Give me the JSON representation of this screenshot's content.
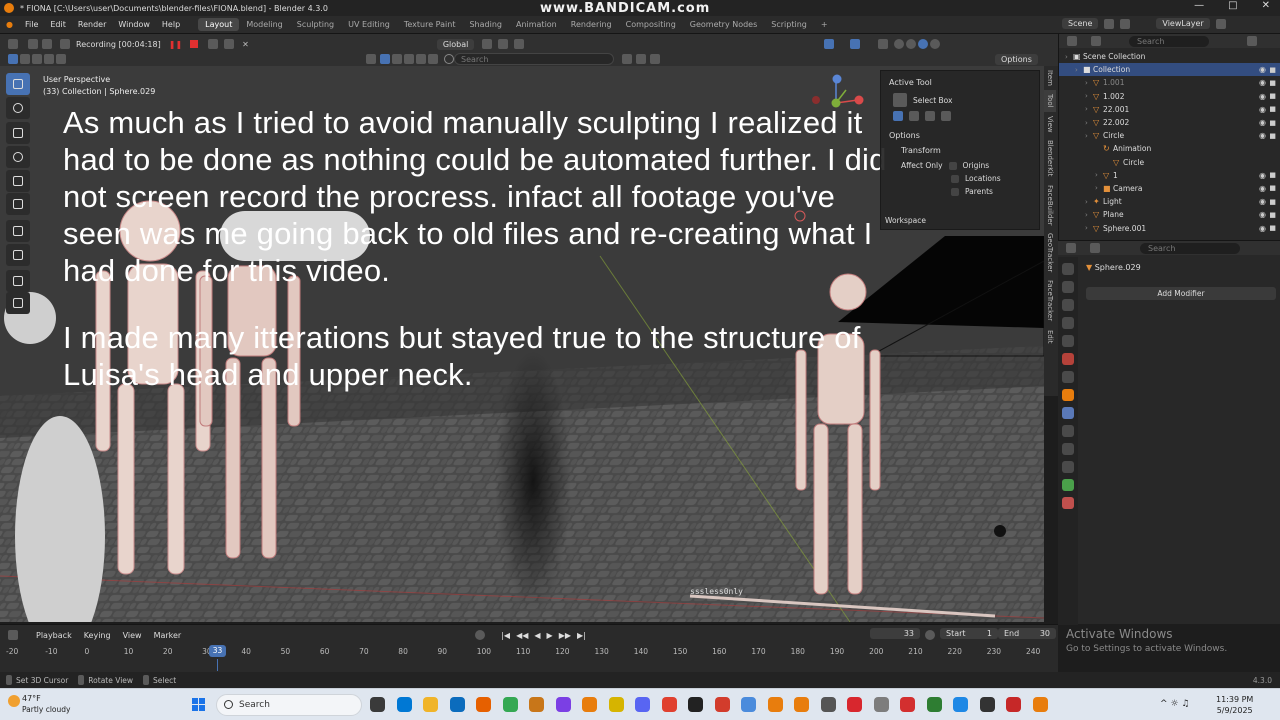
{
  "window": {
    "title": "* FIONA [C:\\Users\\user\\Documents\\blender-files\\FIONA.blend] - Blender 4.3.0",
    "watermark": "www.BANDICAM.com"
  },
  "menu": [
    "File",
    "Edit",
    "Render",
    "Window",
    "Help"
  ],
  "workspaces": [
    "Layout",
    "Modeling",
    "Sculpting",
    "UV Editing",
    "Texture Paint",
    "Shading",
    "Animation",
    "Rendering",
    "Compositing",
    "Geometry Nodes",
    "Scripting"
  ],
  "scene": {
    "name": "Scene",
    "view_layer": "ViewLayer"
  },
  "viewport": {
    "recording": "Recording [00:04:18]",
    "orientation": "Global",
    "search_placeholder": "Search",
    "options": "Options",
    "perspective": "User Perspective",
    "collection_info": "(33) Collection | Sphere.029",
    "caption_p1": "As much as I tried to avoid manually sculpting I realized it had to be done as nothing could be automated further. I did not screen record the procress. infact all footage you've seen was me going back to old files and re-creating what I had done for this video.",
    "caption_p2": "I made many itterations but stayed true to the structure of Luisa's head and upper neck.",
    "floor_text": "sssless0nly"
  },
  "npanel": {
    "active_tool": "Active Tool",
    "select_box": "Select Box",
    "options": "Options",
    "transform": "Transform",
    "affect_only": "Affect Only",
    "origins": "Origins",
    "locations": "Locations",
    "parents": "Parents",
    "workspace": "Workspace",
    "tabs": [
      "Item",
      "Tool",
      "View",
      "BlenderKit",
      "FaceBuilder",
      "GeoTracker",
      "FaceTracker",
      "Edit"
    ]
  },
  "outliner": {
    "search_placeholder": "Search",
    "items": [
      {
        "label": "Scene Collection",
        "indent": 0,
        "kind": "scene"
      },
      {
        "label": "Collection",
        "indent": 1,
        "kind": "coll",
        "selected": true
      },
      {
        "label": "1.001",
        "indent": 2,
        "kind": "obj",
        "dim": true
      },
      {
        "label": "1.002",
        "indent": 2,
        "kind": "obj"
      },
      {
        "label": "22.001",
        "indent": 2,
        "kind": "obj"
      },
      {
        "label": "22.002",
        "indent": 2,
        "kind": "obj"
      },
      {
        "label": "Circle",
        "indent": 2,
        "kind": "obj"
      },
      {
        "label": "Animation",
        "indent": 3,
        "kind": "anim"
      },
      {
        "label": "Circle",
        "indent": 4,
        "kind": "data"
      },
      {
        "label": "1",
        "indent": 3,
        "kind": "obj"
      },
      {
        "label": "Camera",
        "indent": 3,
        "kind": "cam"
      },
      {
        "label": "Light",
        "indent": 2,
        "kind": "light"
      },
      {
        "label": "Plane",
        "indent": 2,
        "kind": "obj"
      },
      {
        "label": "Sphere.001",
        "indent": 2,
        "kind": "obj"
      }
    ]
  },
  "properties": {
    "search_placeholder": "Search",
    "object_name": "Sphere.029",
    "add_modifier": "Add Modifier"
  },
  "watermark_windows": {
    "line1": "Activate Windows",
    "line2": "Go to Settings to activate Windows."
  },
  "timeline": {
    "menus": [
      "Playback",
      "Keying",
      "View",
      "Marker"
    ],
    "current_frame": "33",
    "start_label": "Start",
    "start": "1",
    "end_label": "End",
    "end": "30",
    "ticks": [
      "-20",
      "-10",
      "0",
      "10",
      "20",
      "30",
      "40",
      "50",
      "60",
      "70",
      "80",
      "90",
      "100",
      "110",
      "120",
      "130",
      "140",
      "150",
      "160",
      "170",
      "180",
      "190",
      "200",
      "210",
      "220",
      "230",
      "240"
    ],
    "cursor": "33"
  },
  "status": {
    "set_cursor": "Set 3D Cursor",
    "rotate": "Rotate View",
    "select": "Select",
    "version": "4.3.0"
  },
  "taskbar": {
    "temp": "47°F",
    "weather": "Partly cloudy",
    "search": "Search",
    "time": "11:39 PM",
    "date": "5/9/2025",
    "app_colors": [
      "#3a3a3a",
      "#0078d4",
      "#f0b429",
      "#0b6cbd",
      "#e66000",
      "#34a853",
      "#c87619",
      "#7b3fe4",
      "#e87d0d",
      "#d6b400",
      "#5865f2",
      "#e0402f",
      "#222222",
      "#d23c2c",
      "#4a8bdc",
      "#e87d0d",
      "#e87d0d",
      "#555555",
      "#d8272e",
      "#7d7d7d",
      "#d32f2f",
      "#2e7d32",
      "#1e88e5",
      "#333333",
      "#c62828",
      "#e87d0d"
    ]
  }
}
